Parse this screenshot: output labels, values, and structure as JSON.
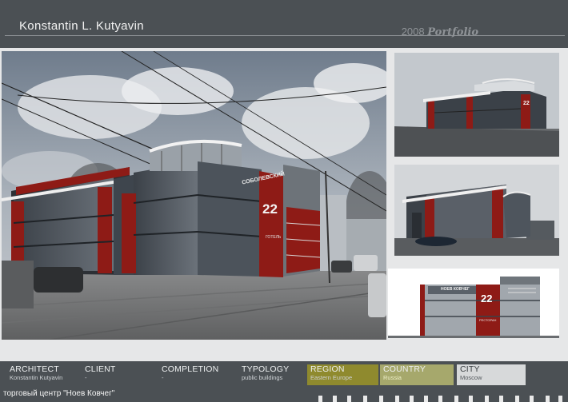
{
  "header": {
    "author": "Konstantin L. Kutyavin",
    "year": "2008",
    "portfolio_word": "Portfolio"
  },
  "images": {
    "main": "photomontage-building-street",
    "view1": "render-aerial",
    "view2": "render-street-corner",
    "view3": "render-facade-elevation"
  },
  "signage": {
    "building_name": "СОБОЛЕВСКИЙ",
    "number": "22",
    "sub": "ГОТЕЛЬ",
    "facade_top": "НОЕВ КОВЧЕГ",
    "facade_sign": "РЕСТОРАН"
  },
  "info": {
    "architect_label": "ARCHITECT",
    "architect_value": "Konstantin Kutyavin",
    "client_label": "CLIENT",
    "client_value": "-",
    "completion_label": "COMPLETION",
    "completion_value": "-",
    "typology_label": "TYPOLOGY",
    "typology_value": "public buildings",
    "region_label": "REGION",
    "region_value": "Eastern Europe",
    "country_label": "COUNTRY",
    "country_value": "Russia",
    "city_label": "CITY",
    "city_value": "Moscow"
  },
  "project_title": "торговый центр \"Ноев Ковчег\"",
  "colors": {
    "background": "#4b5054",
    "panel": "#e6e7e8",
    "accent_red": "#8e1b16",
    "region": "#8f8a2e",
    "country": "#a6a86c"
  }
}
